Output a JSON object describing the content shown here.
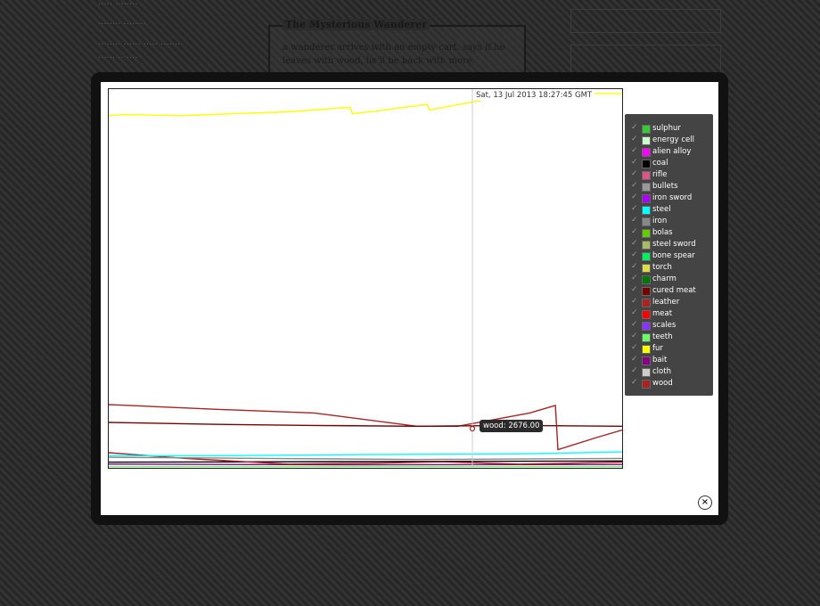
{
  "event": {
    "title": "The Mysterious Wanderer",
    "description": "a wanderer arrives with an empty cart. says if he leaves with wood, he'll be back with more."
  },
  "chart": {
    "timestamp": "Sat, 13 Jul 2013 18:27:45 GMT",
    "tooltip": "wood: 2676.00",
    "close_label": "×"
  },
  "legend": [
    {
      "name": "sulphur",
      "color": "#33cc33"
    },
    {
      "name": "energy cell",
      "color": "#ccffcc"
    },
    {
      "name": "alien alloy",
      "color": "#ff00ff"
    },
    {
      "name": "coal",
      "color": "#000000"
    },
    {
      "name": "rifle",
      "color": "#dd5588"
    },
    {
      "name": "bullets",
      "color": "#999999"
    },
    {
      "name": "iron sword",
      "color": "#aa00ff"
    },
    {
      "name": "steel",
      "color": "#00ffff"
    },
    {
      "name": "iron",
      "color": "#888888"
    },
    {
      "name": "bolas",
      "color": "#66cc00"
    },
    {
      "name": "steel sword",
      "color": "#aabb66"
    },
    {
      "name": "bone spear",
      "color": "#00ee66"
    },
    {
      "name": "torch",
      "color": "#dddd44"
    },
    {
      "name": "charm",
      "color": "#007700"
    },
    {
      "name": "cured meat",
      "color": "#770000"
    },
    {
      "name": "leather",
      "color": "#aa2222"
    },
    {
      "name": "meat",
      "color": "#ff0000"
    },
    {
      "name": "scales",
      "color": "#8833ff"
    },
    {
      "name": "teeth",
      "color": "#66ff66"
    },
    {
      "name": "fur",
      "color": "#ffff00"
    },
    {
      "name": "bait",
      "color": "#880088"
    },
    {
      "name": "cloth",
      "color": "#cccccc"
    },
    {
      "name": "wood",
      "color": "#aa2222"
    }
  ],
  "chart_data": {
    "type": "line",
    "series": [
      {
        "name": "fur",
        "color": "#ffff00",
        "points": [
          [
            0,
            0.07
          ],
          [
            0.03,
            0.067
          ],
          [
            0.07,
            0.068
          ],
          [
            0.14,
            0.07
          ],
          [
            0.2,
            0.067
          ],
          [
            0.35,
            0.06
          ],
          [
            0.47,
            0.048
          ],
          [
            0.475,
            0.065
          ],
          [
            0.52,
            0.058
          ],
          [
            0.62,
            0.04
          ],
          [
            0.625,
            0.055
          ],
          [
            0.7,
            0.036
          ],
          [
            0.8,
            0.013
          ],
          [
            0.9,
            0.01
          ],
          [
            1.0,
            0.012
          ]
        ]
      },
      {
        "name": "cured meat",
        "color": "#770000",
        "points": [
          [
            0,
            0.88
          ],
          [
            0.2,
            0.885
          ],
          [
            0.4,
            0.888
          ],
          [
            0.6,
            0.89
          ],
          [
            0.8,
            0.888
          ],
          [
            1.0,
            0.89
          ]
        ]
      },
      {
        "name": "wood",
        "color": "#aa2222",
        "points": [
          [
            0,
            0.833
          ],
          [
            0.2,
            0.845
          ],
          [
            0.4,
            0.855
          ],
          [
            0.6,
            0.89
          ],
          [
            0.68,
            0.89
          ],
          [
            0.82,
            0.855
          ],
          [
            0.87,
            0.835
          ],
          [
            0.875,
            0.952
          ],
          [
            0.95,
            0.92
          ],
          [
            1.0,
            0.9
          ]
        ]
      },
      {
        "name": "steel",
        "color": "#00ffff",
        "points": [
          [
            0,
            0.968
          ],
          [
            0.2,
            0.968
          ],
          [
            0.5,
            0.965
          ],
          [
            0.8,
            0.963
          ],
          [
            1.0,
            0.958
          ]
        ]
      },
      {
        "name": "iron",
        "color": "#888888",
        "points": [
          [
            0,
            0.972
          ],
          [
            0.3,
            0.975
          ],
          [
            0.6,
            0.978
          ],
          [
            1.0,
            0.975
          ]
        ]
      },
      {
        "name": "leather",
        "color": "#aa2222",
        "points": [
          [
            0,
            0.96
          ],
          [
            0.15,
            0.975
          ],
          [
            0.35,
            0.99
          ],
          [
            0.5,
            0.988
          ],
          [
            0.65,
            0.984
          ],
          [
            0.8,
            0.99
          ],
          [
            1.0,
            0.985
          ]
        ]
      },
      {
        "name": "coal",
        "color": "#000000",
        "points": [
          [
            0,
            0.985
          ],
          [
            0.3,
            0.984
          ],
          [
            0.6,
            0.983
          ],
          [
            1.0,
            0.982
          ]
        ]
      },
      {
        "name": "bait",
        "color": "#880088",
        "points": [
          [
            0,
            0.99
          ],
          [
            0.5,
            0.992
          ],
          [
            1.0,
            0.991
          ]
        ]
      },
      {
        "name": "teeth",
        "color": "#66ff66",
        "points": [
          [
            0,
            0.997
          ],
          [
            0.5,
            0.997
          ],
          [
            1.0,
            0.997
          ]
        ]
      }
    ]
  }
}
